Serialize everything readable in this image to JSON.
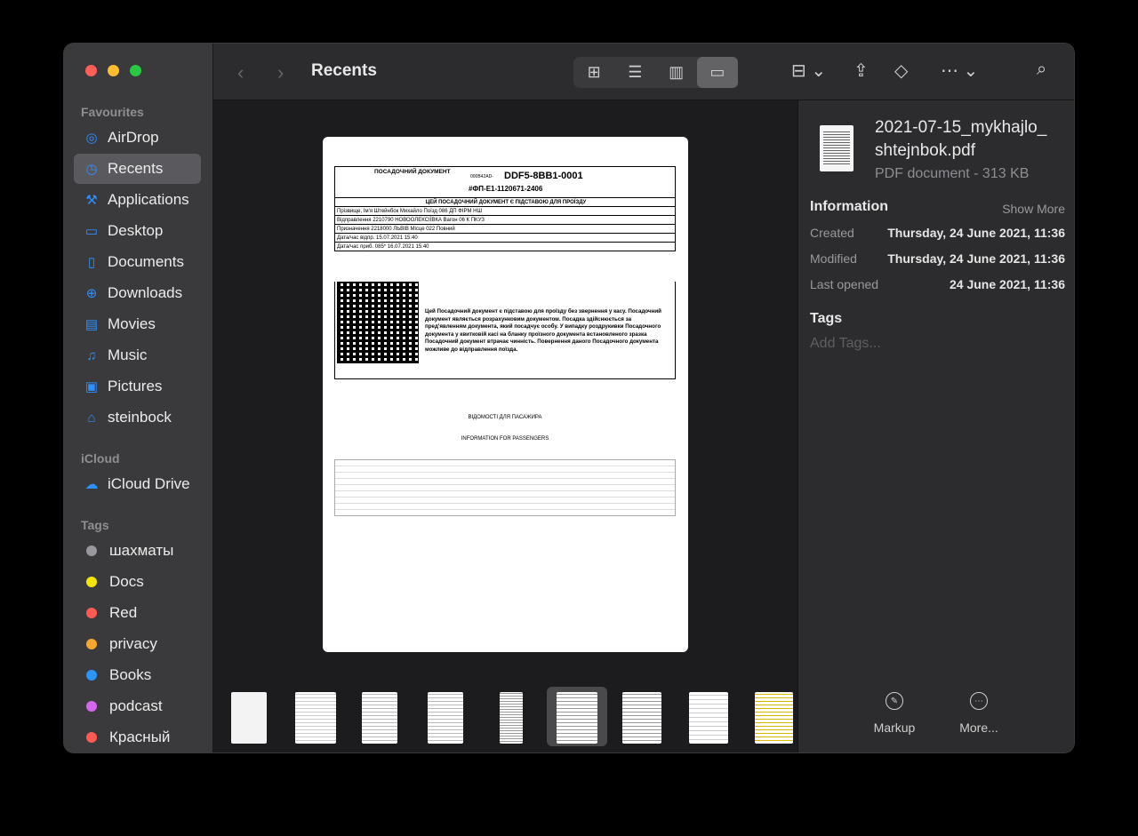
{
  "window": {
    "title": "Recents"
  },
  "sidebar": {
    "favourites_label": "Favourites",
    "items": [
      {
        "label": "AirDrop",
        "icon": "airdrop-icon"
      },
      {
        "label": "Recents",
        "icon": "clock-icon"
      },
      {
        "label": "Applications",
        "icon": "applications-icon"
      },
      {
        "label": "Desktop",
        "icon": "desktop-icon"
      },
      {
        "label": "Documents",
        "icon": "document-icon"
      },
      {
        "label": "Downloads",
        "icon": "download-icon"
      },
      {
        "label": "Movies",
        "icon": "film-icon"
      },
      {
        "label": "Music",
        "icon": "music-icon"
      },
      {
        "label": "Pictures",
        "icon": "photo-icon"
      },
      {
        "label": "steinbock",
        "icon": "home-icon"
      }
    ],
    "icloud_label": "iCloud",
    "icloud_drive": "iCloud Drive",
    "tags_label": "Tags",
    "tags": [
      {
        "label": "шахматы",
        "color": "#98989d"
      },
      {
        "label": "Docs",
        "color": "#f5e500"
      },
      {
        "label": "Red",
        "color": "#ff5b54"
      },
      {
        "label": "privacy",
        "color": "#f7a62b"
      },
      {
        "label": "Books",
        "color": "#2b94ff"
      },
      {
        "label": "podcast",
        "color": "#d865f0"
      },
      {
        "label": "Красный",
        "color": "#ff5b54"
      }
    ]
  },
  "preview": {
    "code": "DDF5-8BB1-0001",
    "prefix": "000B42AD-",
    "header_title": "ПОСАДОЧНИЙ ДОКУМЕНТ",
    "sub": "ЦЕЙ ПОСАДОЧНИЙ ДОКУМЕНТ Є ПІДСТАВОЮ ДЛЯ ПРОЇЗДУ",
    "fiscal": "#ФП-Е1-1120671-2406",
    "lines": [
      "Прізвище, Ім'я   Штейнбок Михайло   Поїзд 086 ДП ФІРМ НШ",
      "Відправлення 2210790 НОВООЛЕКСІЇВКА   Вагон 06 К ПКУЗ",
      "Призначення 2218000 ЛЬВІВ   Місце 022 Повний",
      "Дата/час відпр. 15.07.2021 15:40",
      "Дата/час приб. 085* 16.07.2021 15:40"
    ],
    "notice": "Цей Посадочний документ є підставою для проїзду без звернення у касу. Посадочний документ являється розрахунковим документом. Посадка здійснюється за пред'явленням документа, який посадчує особу. У випадку роздрукивки Посадочного документа у квитковій касі на бланку проїзного документа встановленого зразка Посадочний документ втрачає чинність. Повернення даного Посадочного документа можливе до відправлення поїзда.",
    "passenger_info": "ВІДОМОСТІ ДЛЯ ПАСАЖИРА",
    "passenger_info_en": "INFORMATION FOR PASSENGERS"
  },
  "info": {
    "filename": "2021-07-15_mykhajlo_shtejnbok.pdf",
    "filename_line1": "2021-07-15_mykhajlo_",
    "filename_line2": "shtejnbok.pdf",
    "meta": "PDF document - 313 KB",
    "information_label": "Information",
    "show_more": "Show More",
    "rows": [
      {
        "label": "Created",
        "value": "Thursday, 24 June 2021, 11:36"
      },
      {
        "label": "Modified",
        "value": "Thursday, 24 June 2021, 11:36"
      },
      {
        "label": "Last opened",
        "value": "24 June 2021, 11:36"
      }
    ],
    "tags_label": "Tags",
    "add_tags": "Add Tags...",
    "markup": "Markup",
    "more": "More..."
  }
}
